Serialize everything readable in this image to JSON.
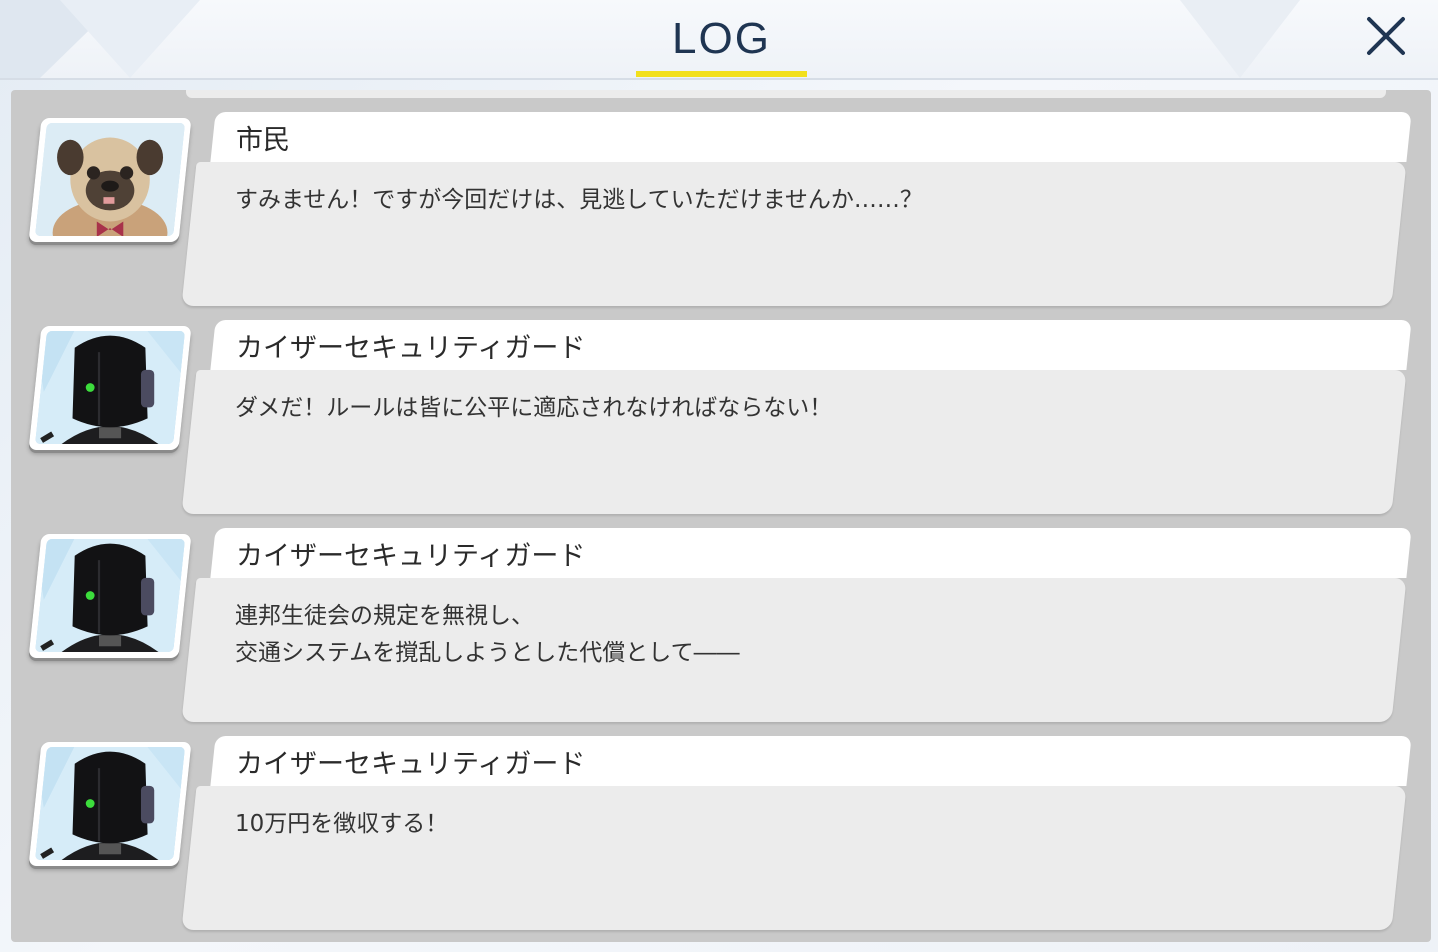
{
  "header": {
    "title": "LOG"
  },
  "entries": [
    {
      "speaker": "市民",
      "avatar_icon": "pug-citizen-avatar",
      "text": "すみません！ですが今回だけは、見逃していただけませんか……？"
    },
    {
      "speaker": "カイザーセキュリティガード",
      "avatar_icon": "robot-guard-avatar",
      "text": "ダメだ！ルールは皆に公平に適応されなければならない！"
    },
    {
      "speaker": "カイザーセキュリティガード",
      "avatar_icon": "robot-guard-avatar",
      "text": "連邦生徒会の規定を無視し、\n交通システムを撹乱しようとした代償として――"
    },
    {
      "speaker": "カイザーセキュリティガード",
      "avatar_icon": "robot-guard-avatar",
      "text": "10万円を徴収する！"
    }
  ],
  "colors": {
    "title": "#1f3552",
    "underline": "#f2e01c",
    "panel": "#c9c9c9",
    "message_bg": "#ececec",
    "name_bg": "#ffffff",
    "guard_eye": "#3cdc3c"
  }
}
